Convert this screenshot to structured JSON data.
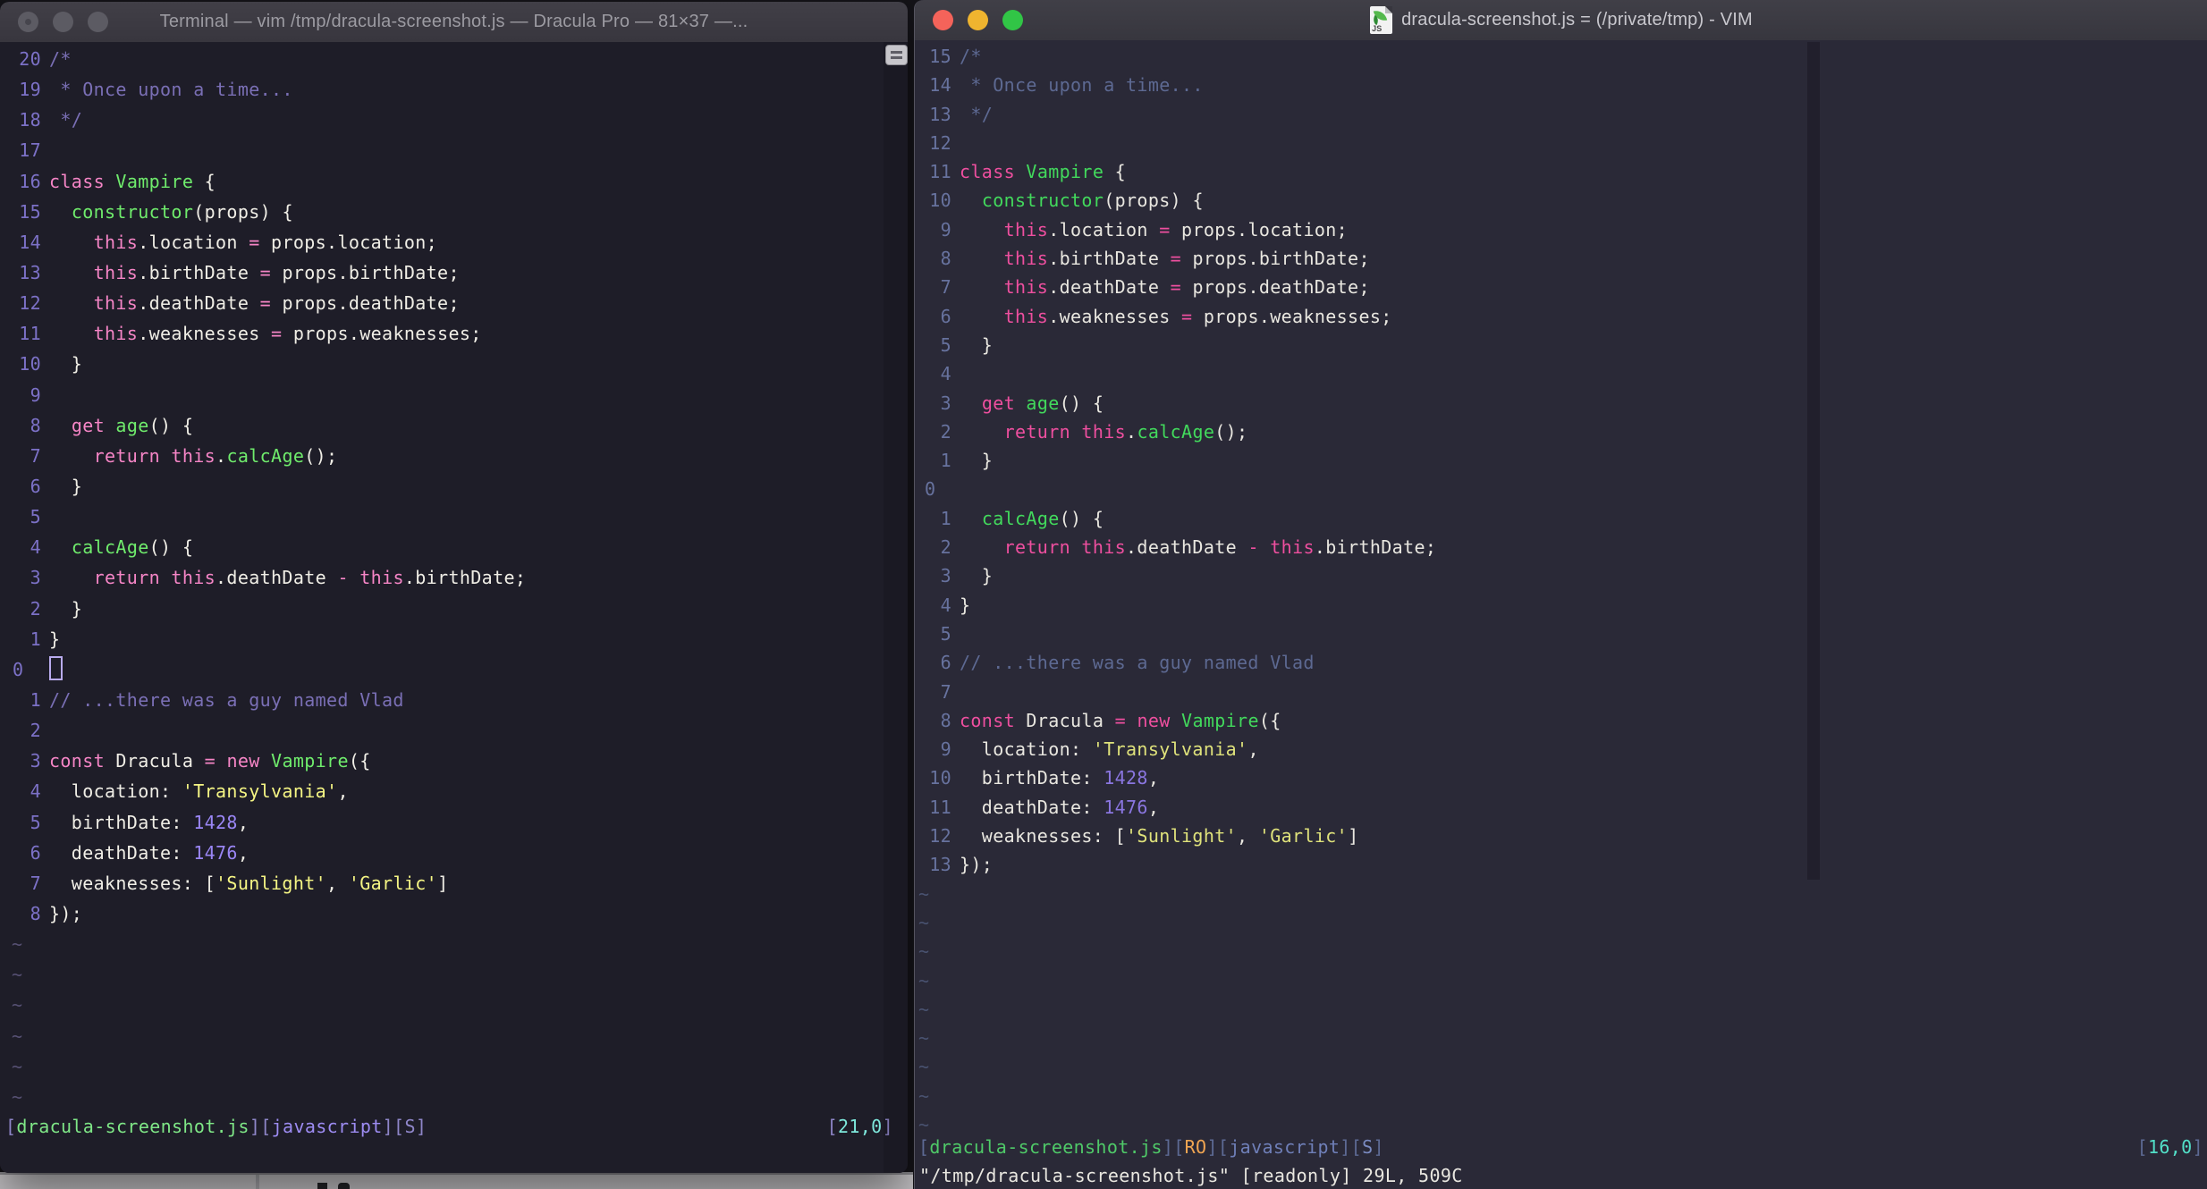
{
  "desktop": {
    "strip_color": "#C6C4C7",
    "note": "light strip of an occluded window visible under the left terminal"
  },
  "code_lines": [
    [
      [
        "c",
        "/*"
      ]
    ],
    [
      [
        "c",
        " * Once upon a time..."
      ]
    ],
    [
      [
        "c",
        " */"
      ]
    ],
    [],
    [
      [
        "p",
        "class"
      ],
      [
        "f",
        " "
      ],
      [
        "g",
        "Vampire"
      ],
      [
        "f",
        " {"
      ]
    ],
    [
      [
        "f",
        "  "
      ],
      [
        "g",
        "constructor"
      ],
      [
        "f",
        "(props) {"
      ]
    ],
    [
      [
        "f",
        "    "
      ],
      [
        "p",
        "this"
      ],
      [
        "f",
        ".location "
      ],
      [
        "p",
        "="
      ],
      [
        "f",
        " props.location;"
      ]
    ],
    [
      [
        "f",
        "    "
      ],
      [
        "p",
        "this"
      ],
      [
        "f",
        ".birthDate "
      ],
      [
        "p",
        "="
      ],
      [
        "f",
        " props.birthDate;"
      ]
    ],
    [
      [
        "f",
        "    "
      ],
      [
        "p",
        "this"
      ],
      [
        "f",
        ".deathDate "
      ],
      [
        "p",
        "="
      ],
      [
        "f",
        " props.deathDate;"
      ]
    ],
    [
      [
        "f",
        "    "
      ],
      [
        "p",
        "this"
      ],
      [
        "f",
        ".weaknesses "
      ],
      [
        "p",
        "="
      ],
      [
        "f",
        " props.weaknesses;"
      ]
    ],
    [
      [
        "f",
        "  }"
      ]
    ],
    [],
    [
      [
        "f",
        "  "
      ],
      [
        "p",
        "get"
      ],
      [
        "f",
        " "
      ],
      [
        "g",
        "age"
      ],
      [
        "f",
        "() {"
      ]
    ],
    [
      [
        "f",
        "    "
      ],
      [
        "p",
        "return"
      ],
      [
        "f",
        " "
      ],
      [
        "p",
        "this"
      ],
      [
        "f",
        "."
      ],
      [
        "g",
        "calcAge"
      ],
      [
        "f",
        "();"
      ]
    ],
    [
      [
        "f",
        "  }"
      ]
    ],
    [],
    [
      [
        "f",
        "  "
      ],
      [
        "g",
        "calcAge"
      ],
      [
        "f",
        "() {"
      ]
    ],
    [
      [
        "f",
        "    "
      ],
      [
        "p",
        "return"
      ],
      [
        "f",
        " "
      ],
      [
        "p",
        "this"
      ],
      [
        "f",
        ".deathDate "
      ],
      [
        "p",
        "-"
      ],
      [
        "f",
        " "
      ],
      [
        "p",
        "this"
      ],
      [
        "f",
        ".birthDate;"
      ]
    ],
    [
      [
        "f",
        "  }"
      ]
    ],
    [
      [
        "f",
        "}"
      ]
    ],
    [],
    [
      [
        "c",
        "// ...there was a guy named Vlad"
      ]
    ],
    [],
    [
      [
        "p",
        "const"
      ],
      [
        "f",
        " Dracula "
      ],
      [
        "p",
        "="
      ],
      [
        "f",
        " "
      ],
      [
        "p",
        "new"
      ],
      [
        "f",
        " "
      ],
      [
        "g",
        "Vampire"
      ],
      [
        "f",
        "({"
      ]
    ],
    [
      [
        "f",
        "  location: "
      ],
      [
        "y",
        "'Transylvania'"
      ],
      [
        "f",
        ","
      ]
    ],
    [
      [
        "f",
        "  birthDate: "
      ],
      [
        "n",
        "1428"
      ],
      [
        "f",
        ","
      ]
    ],
    [
      [
        "f",
        "  deathDate: "
      ],
      [
        "n",
        "1476"
      ],
      [
        "f",
        ","
      ]
    ],
    [
      [
        "f",
        "  weaknesses: ["
      ],
      [
        "y",
        "'Sunlight'"
      ],
      [
        "f",
        ", "
      ],
      [
        "y",
        "'Garlic'"
      ],
      [
        "f",
        "]"
      ]
    ],
    [
      [
        "f",
        "});"
      ]
    ]
  ],
  "windows": {
    "left": {
      "app": "Terminal",
      "title": "Terminal — vim /tmp/dracula-screenshot.js — Dracula Pro — 81×37 —...",
      "focused": false,
      "cursor_line": 21,
      "cursor_style": "hollow",
      "show_cursor": true,
      "tilde_rows": 6,
      "status": {
        "segments": [
          [
            "br",
            "["
          ],
          [
            "file",
            "dracula-screenshot.js"
          ],
          [
            "br",
            "]["
          ],
          [
            "lang",
            "javascript"
          ],
          [
            "br",
            "]["
          ],
          [
            "s",
            "S"
          ],
          [
            "br",
            "]"
          ]
        ],
        "position": [
          [
            "br",
            "["
          ],
          [
            "cy",
            "21,0"
          ],
          [
            "br",
            "]"
          ]
        ]
      },
      "command_line": "",
      "palette": {
        "bg": "#1E1D28",
        "fg": "#F0EEE6",
        "comment": "#7A6FB5",
        "pink": "#F585C6",
        "green": "#6FEB6C",
        "purple": "#9A86F5",
        "yellow": "#F5F584",
        "gutter": "#7C71C7",
        "tilde": "#565073",
        "cursor": "#B9ABED",
        "sbr": "#8F86C9",
        "sfile": "#7FE787",
        "slang": "#9D8CF2",
        "ss": "#8F86C9",
        "scy": "#7EE8DC",
        "traffic_light_inactive": "#5C5B63"
      }
    },
    "right": {
      "app": "MacVim",
      "title": "dracula-screenshot.js = (/private/tmp) - VIM",
      "doc_icon_label": "JS",
      "focused": true,
      "cursor_line": 16,
      "cursor_style": "hidden",
      "show_cursor": false,
      "tilde_rows": 9,
      "status": {
        "segments": [
          [
            "br",
            "["
          ],
          [
            "file",
            "dracula-screenshot.js"
          ],
          [
            "br",
            "]["
          ],
          [
            "ro",
            "RO"
          ],
          [
            "br",
            "]["
          ],
          [
            "lang",
            "javascript"
          ],
          [
            "br",
            "]["
          ],
          [
            "s",
            "S"
          ],
          [
            "br",
            "]"
          ]
        ],
        "position": [
          [
            "br",
            "["
          ],
          [
            "cy",
            "16,0"
          ],
          [
            "br",
            "]"
          ]
        ]
      },
      "command_line": "\"/tmp/dracula-screenshot.js\" [readonly] 29L, 509C",
      "palette": {
        "bg": "#2A2937",
        "fg": "#E9E7E0",
        "comment": "#5D6992",
        "pink": "#EE4F9F",
        "green": "#42D95C",
        "purple": "#8A76E0",
        "yellow": "#DFE27B",
        "gutter": "#67729E",
        "tilde": "#495270",
        "cursor": "#E9E7E0",
        "cc": "#211F2C",
        "sbr": "#5D6A94",
        "sfile": "#4FC968",
        "slang": "#6F7FB8",
        "ss": "#7A8AC0",
        "scy": "#52E0C8",
        "sro": "#F0A552",
        "traffic_red": "#F4635A",
        "traffic_yellow": "#EFB42F",
        "traffic_green": "#31C546"
      }
    }
  }
}
